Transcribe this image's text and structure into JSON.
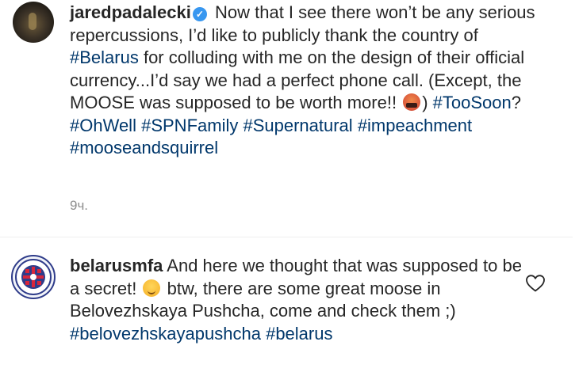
{
  "post": {
    "author": "jaredpadalecki",
    "verified_icon": "verified-badge-icon",
    "text_part1": " Now that I see there won’t be any serious repercussions, I’d like to publicly thank the country of ",
    "tag_belarus": "#Belarus",
    "text_part2": " for colluding with me on the design of their official currency...I’d say we had a perfect phone call. (Except, the MOOSE was supposed to be worth more!! ",
    "emoji1": "angry-face-emoji",
    "text_part3": ") ",
    "tag_toosoon": "#TooSoon",
    "text_part4": "? ",
    "tag_ohwell": "#OhWell",
    "tag_spnfamily": "#SPNFamily",
    "tag_supernatural": "#Supernatural",
    "tag_impeachment": "#impeachment",
    "tag_moose": "#mooseandsquirrel",
    "time": "9ч."
  },
  "comment": {
    "author": "belarusmfa",
    "text_part1": " And here we thought that was supposed to be a secret! ",
    "emoji": "smirking-face-emoji",
    "text_part2": " btw, there are some great moose in Belovezhskaya Pushcha, come and check them ;) ",
    "tag_pushcha": "#belovezhskayapushcha",
    "tag_belarus": "#belarus",
    "like_icon": "heart-icon"
  }
}
